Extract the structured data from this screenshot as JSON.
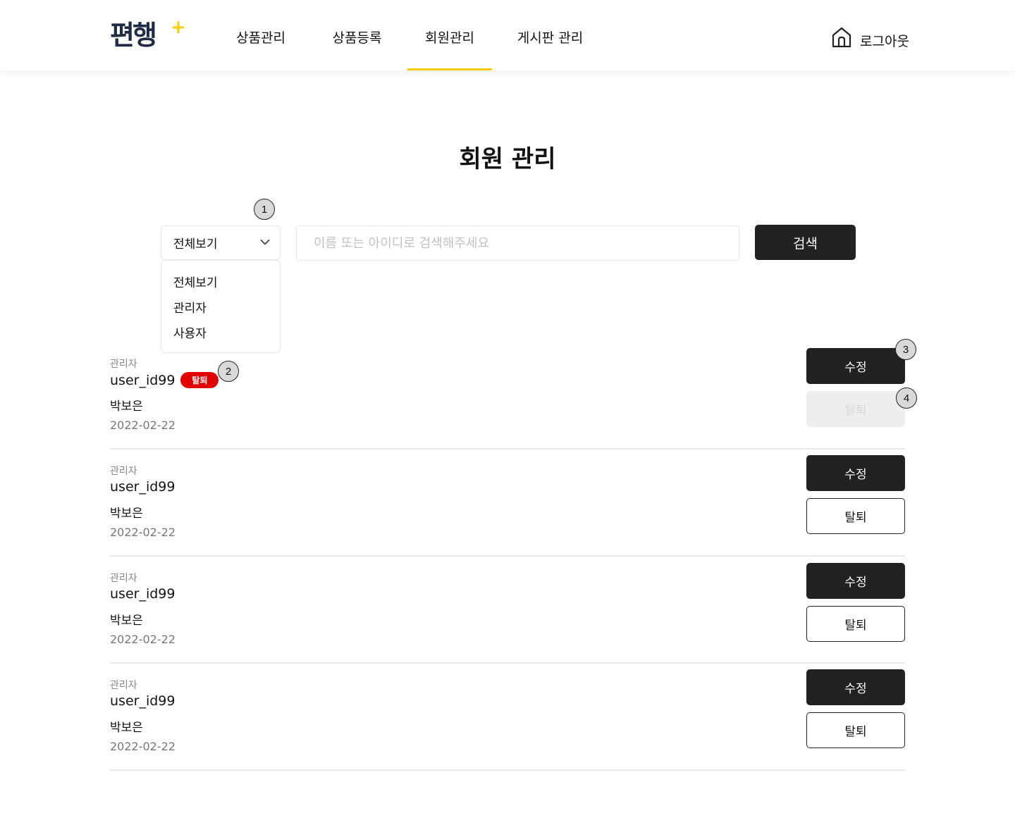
{
  "header": {
    "logo": "편행",
    "logo_mark": "+",
    "nav": [
      {
        "label": "상품관리",
        "active": false
      },
      {
        "label": "상품등록",
        "active": false
      },
      {
        "label": "회원관리",
        "active": true
      },
      {
        "label": "게시판 관리",
        "active": false
      }
    ],
    "logout_label": "로그아웃",
    "logout_icon": "home-icon"
  },
  "page": {
    "title": "회원 관리"
  },
  "filter": {
    "selected": "전체보기",
    "options": [
      "전체보기",
      "관리자",
      "사용자"
    ]
  },
  "search": {
    "placeholder": "이름 또는 아이디로 검색해주세요",
    "button_label": "검색"
  },
  "annotations": [
    "1",
    "2",
    "3",
    "4"
  ],
  "members": [
    {
      "role": "관리자",
      "user_id": "user_id99",
      "badge": "탈퇴",
      "name": "박보은",
      "date": "2022-02-22",
      "edit_label": "수정",
      "delete_label": "탈퇴",
      "delete_disabled": true
    },
    {
      "role": "관리자",
      "user_id": "user_id99",
      "name": "박보은",
      "date": "2022-02-22",
      "edit_label": "수정",
      "delete_label": "탈퇴",
      "delete_disabled": false
    },
    {
      "role": "관리자",
      "user_id": "user_id99",
      "name": "박보은",
      "date": "2022-02-22",
      "edit_label": "수정",
      "delete_label": "탈퇴",
      "delete_disabled": false
    },
    {
      "role": "관리자",
      "user_id": "user_id99",
      "name": "박보은",
      "date": "2022-02-22",
      "edit_label": "수정",
      "delete_label": "탈퇴",
      "delete_disabled": false
    }
  ],
  "colors": {
    "accent": "#ffcc00",
    "dark_button": "#222222",
    "withdrawn_badge": "#e30000",
    "logo": "#1f2a44"
  }
}
